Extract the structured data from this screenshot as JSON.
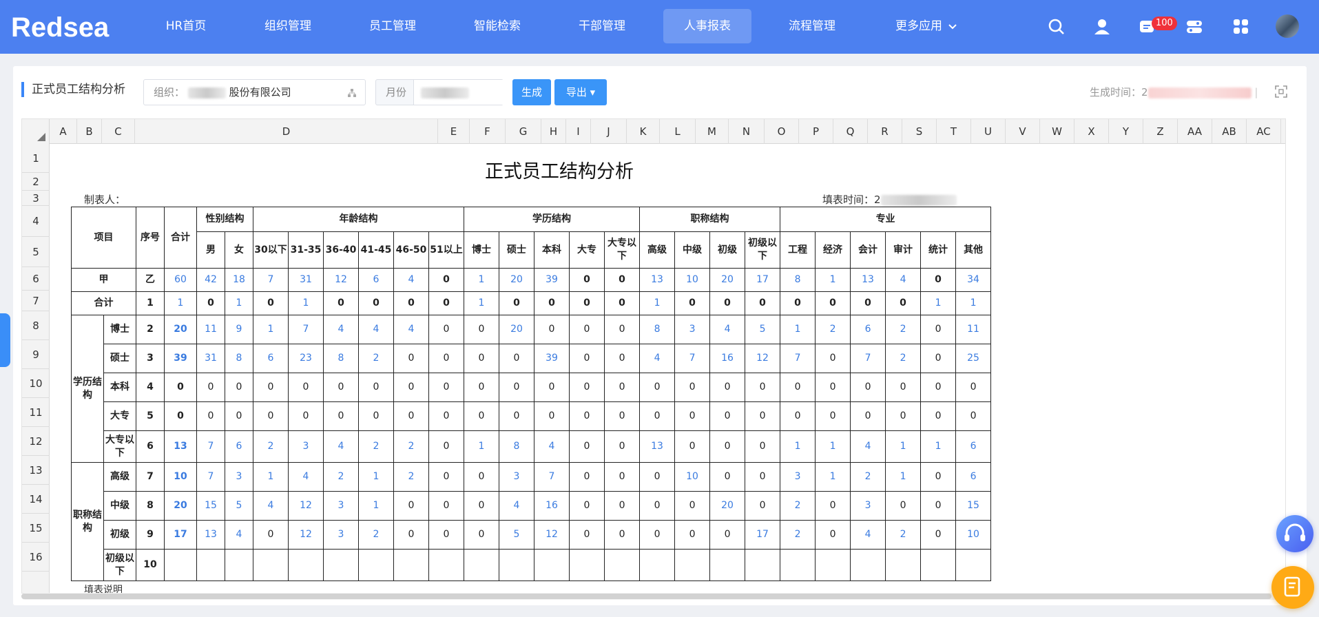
{
  "nav": {
    "logo": "Redsea",
    "items": [
      "HR首页",
      "组织管理",
      "员工管理",
      "智能检索",
      "干部管理",
      "人事报表",
      "流程管理",
      "更多应用"
    ],
    "active": "人事报表",
    "badge": "100"
  },
  "toolbar": {
    "page_title": "正式员工结构分析",
    "org_label": "组织：",
    "org_value": "股份有限公司",
    "month_label": "月份",
    "generate_label": "生成",
    "export_label": "导出",
    "gen_time_label": "生成时间：",
    "gen_time_prefix": "2"
  },
  "sheet": {
    "columns": [
      "A",
      "B",
      "C",
      "D",
      "E",
      "F",
      "G",
      "H",
      "I",
      "J",
      "K",
      "L",
      "M",
      "N",
      "O",
      "P",
      "Q",
      "R",
      "S",
      "T",
      "U",
      "V",
      "W",
      "X",
      "Y",
      "Z",
      "AA",
      "AB",
      "AC"
    ],
    "rows": [
      "1",
      "2",
      "3",
      "4",
      "5",
      "6",
      "7",
      "8",
      "9",
      "10",
      "11",
      "12",
      "13",
      "14",
      "15",
      "16"
    ]
  },
  "report": {
    "title": "正式员工结构分析",
    "maker_label": "制表人：",
    "fill_time_label": "填表时间：",
    "fill_time_prefix": "2",
    "note": "填表说明",
    "header_top": {
      "item": "项目",
      "seq": "序号",
      "total": "合计",
      "gender": "性别结构",
      "age": "年龄结构",
      "edu": "学历结构",
      "title": "职称结构",
      "major": "专业"
    },
    "header_sub": [
      "男",
      "女",
      "30以下",
      "31-35",
      "36-40",
      "41-45",
      "46-50",
      "51以上",
      "博士",
      "硕士",
      "本科",
      "大专",
      "大专以下",
      "高级",
      "中级",
      "初级",
      "初级以下",
      "工程",
      "经济",
      "会计",
      "审计",
      "统计",
      "其他"
    ],
    "row_jia": {
      "label": "甲",
      "seq": "乙",
      "values": [
        "60",
        "42",
        "18",
        "7",
        "31",
        "12",
        "6",
        "4",
        "0",
        "1",
        "20",
        "39",
        "0",
        "0",
        "13",
        "10",
        "20",
        "17",
        "8",
        "1",
        "13",
        "4",
        "0",
        "34"
      ]
    },
    "row_total": {
      "label": "合计",
      "seq": "1",
      "values": [
        "1",
        "0",
        "1",
        "0",
        "1",
        "0",
        "0",
        "0",
        "0",
        "1",
        "0",
        "0",
        "0",
        "0",
        "1",
        "0",
        "0",
        "0",
        "0",
        "0",
        "0",
        "0",
        "1",
        "1"
      ]
    },
    "group_edu": "学历结构",
    "group_title": "职称结构",
    "rows": [
      {
        "label": "博士",
        "seq": "2",
        "values": [
          "20",
          "11",
          "9",
          "1",
          "7",
          "4",
          "4",
          "4",
          "0",
          "0",
          "20",
          "0",
          "0",
          "0",
          "8",
          "3",
          "4",
          "5",
          "1",
          "2",
          "6",
          "2",
          "0",
          "11"
        ]
      },
      {
        "label": "硕士",
        "seq": "3",
        "values": [
          "39",
          "31",
          "8",
          "6",
          "23",
          "8",
          "2",
          "0",
          "0",
          "0",
          "0",
          "39",
          "0",
          "0",
          "4",
          "7",
          "16",
          "12",
          "7",
          "0",
          "7",
          "2",
          "0",
          "25"
        ]
      },
      {
        "label": "本科",
        "seq": "4",
        "values": [
          "0",
          "0",
          "0",
          "0",
          "0",
          "0",
          "0",
          "0",
          "0",
          "0",
          "0",
          "0",
          "0",
          "0",
          "0",
          "0",
          "0",
          "0",
          "0",
          "0",
          "0",
          "0",
          "0",
          "0"
        ]
      },
      {
        "label": "大专",
        "seq": "5",
        "values": [
          "0",
          "0",
          "0",
          "0",
          "0",
          "0",
          "0",
          "0",
          "0",
          "0",
          "0",
          "0",
          "0",
          "0",
          "0",
          "0",
          "0",
          "0",
          "0",
          "0",
          "0",
          "0",
          "0",
          "0"
        ]
      },
      {
        "label": "大专以下",
        "seq": "6",
        "values": [
          "13",
          "7",
          "6",
          "2",
          "3",
          "4",
          "2",
          "2",
          "0",
          "1",
          "8",
          "4",
          "0",
          "0",
          "13",
          "0",
          "0",
          "0",
          "1",
          "1",
          "4",
          "1",
          "1",
          "6"
        ]
      },
      {
        "label": "高级",
        "seq": "7",
        "values": [
          "10",
          "7",
          "3",
          "1",
          "4",
          "2",
          "1",
          "2",
          "0",
          "0",
          "3",
          "7",
          "0",
          "0",
          "0",
          "10",
          "0",
          "0",
          "3",
          "1",
          "2",
          "1",
          "0",
          "6"
        ]
      },
      {
        "label": "中级",
        "seq": "8",
        "values": [
          "20",
          "15",
          "5",
          "4",
          "12",
          "3",
          "1",
          "0",
          "0",
          "0",
          "4",
          "16",
          "0",
          "0",
          "0",
          "0",
          "20",
          "0",
          "2",
          "0",
          "3",
          "0",
          "0",
          "15"
        ]
      },
      {
        "label": "初级",
        "seq": "9",
        "values": [
          "17",
          "13",
          "4",
          "0",
          "12",
          "3",
          "2",
          "0",
          "0",
          "0",
          "5",
          "12",
          "0",
          "0",
          "0",
          "0",
          "0",
          "17",
          "2",
          "0",
          "4",
          "2",
          "0",
          "10"
        ]
      },
      {
        "label": "初级以下",
        "seq": "10",
        "values": [
          "",
          "",
          "",
          "",
          "",
          "",
          "",
          "",
          "",
          "",
          "",
          "",
          "",
          "",
          "",
          "",
          "",
          "",
          "",
          "",
          "",
          "",
          "",
          ""
        ]
      }
    ]
  },
  "colors": {
    "nav": "#4c80f0",
    "accent": "#3a95f8",
    "link": "#3a7be0",
    "badge": "#f0313a",
    "fab_orange": "#ffaa15"
  }
}
